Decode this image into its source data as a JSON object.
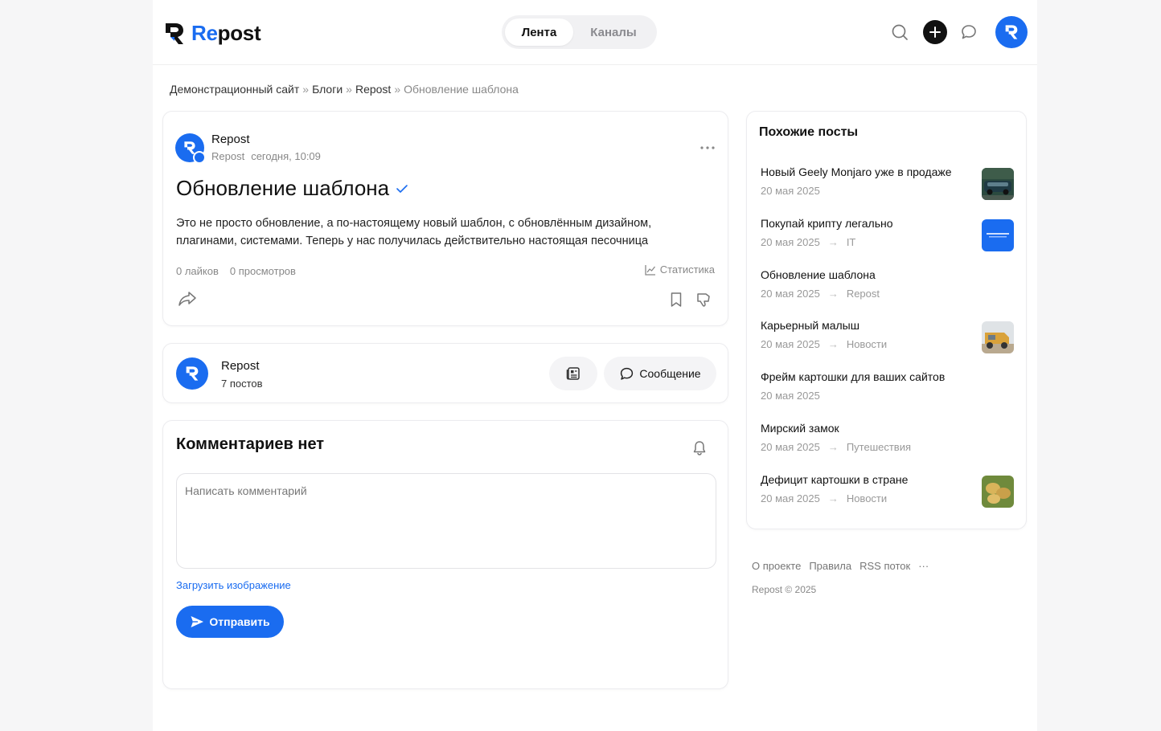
{
  "header": {
    "logo_prefix": "Re",
    "logo_suffix": "post",
    "tabs": [
      {
        "label": "Лента",
        "active": true
      },
      {
        "label": "Каналы",
        "active": false
      }
    ],
    "icons": [
      "search-icon",
      "plus-icon",
      "chat-icon",
      "avatar"
    ]
  },
  "breadcrumb": {
    "items": [
      "Демонстрационный сайт",
      "Блоги",
      "Repost"
    ],
    "separator": "»",
    "current": "Обновление шаблона"
  },
  "post": {
    "author": "Repost",
    "channel": "Repost",
    "time": "сегодня, 10:09",
    "title": "Обновление шаблона",
    "body_line1": "Это не просто обновление, а по-настоящему новый шаблон, с обновлённым дизайном,",
    "body_line2": "плагинами, системами. Теперь у нас получилась действительно настоящая песочница",
    "likes": "0 лайков",
    "views": "0 просмотров",
    "stats_label": "Статистика"
  },
  "author_card": {
    "name": "Repost",
    "posts": "7 постов",
    "message_label": "Сообщение"
  },
  "comments": {
    "title": "Комментариев нет",
    "placeholder": "Написать комментарий",
    "upload_label": "Загрузить изображение",
    "send_label": "Отправить"
  },
  "similar": {
    "title": "Похожие посты",
    "items": [
      {
        "title": "Новый Geely Monjaro уже в продаже",
        "date": "20 мая 2025",
        "category": "",
        "thumb": "car"
      },
      {
        "title": "Покупай крипту легально",
        "date": "20 мая 2025",
        "category": "IT",
        "thumb": "blue"
      },
      {
        "title": "Обновление шаблона",
        "date": "20 мая 2025",
        "category": "Repost",
        "thumb": ""
      },
      {
        "title": "Карьерный малыш",
        "date": "20 мая 2025",
        "category": "Новости",
        "thumb": "truck"
      },
      {
        "title": "Фрейм картошки для ваших сайтов",
        "date": "20 мая 2025",
        "category": "",
        "thumb": ""
      },
      {
        "title": "Мирский замок",
        "date": "20 мая 2025",
        "category": "Путешествия",
        "thumb": ""
      },
      {
        "title": "Дефицит картошки в стране",
        "date": "20 мая 2025",
        "category": "Новости",
        "thumb": "potato"
      }
    ]
  },
  "footer": {
    "links": [
      "О проекте",
      "Правила",
      "RSS поток"
    ],
    "more": "···",
    "copyright": "Repost © 2025"
  },
  "colors": {
    "accent": "#1a6cf0",
    "text": "#111111",
    "muted": "#888888",
    "background": "#f6f6f7"
  }
}
